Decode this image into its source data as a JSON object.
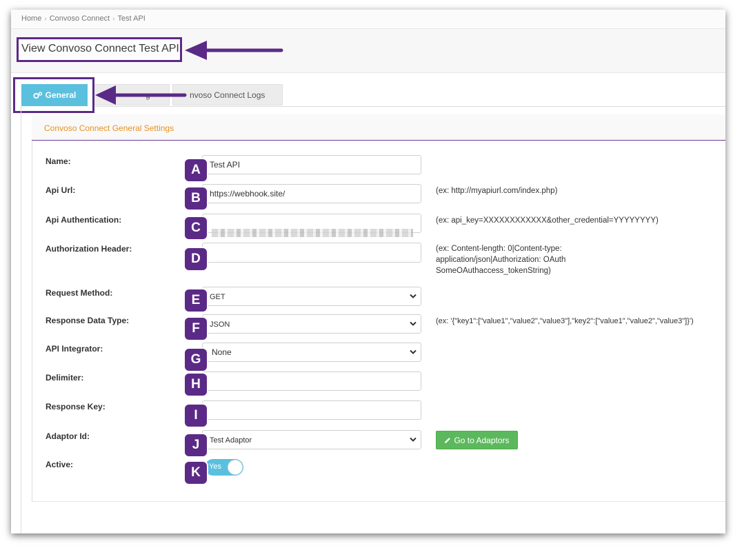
{
  "breadcrumb": {
    "home": "Home",
    "parent": "Convoso Connect",
    "current": "Test API"
  },
  "page_title": "View Convoso Connect Test API",
  "tabs": {
    "general": "General",
    "hidden_fragment": "g",
    "logs": "nvoso Connect Logs"
  },
  "panel_title": "Convoso Connect General Settings",
  "fields": {
    "name": {
      "label": "Name:",
      "value": "Test API",
      "badge": "A"
    },
    "api_url": {
      "label": "Api Url:",
      "value": "https://webhook.site/",
      "hint": "(ex: http://myapiurl.com/index.php)",
      "badge": "B"
    },
    "api_auth": {
      "label": "Api Authentication:",
      "hint": "(ex: api_key=XXXXXXXXXXXX&other_credential=YYYYYYYY)",
      "badge": "C"
    },
    "auth_header": {
      "label": "Authorization Header:",
      "hint_line1": "(ex: Content-length: 0|Content-type:",
      "hint_line2": "application/json|Authorization: OAuth",
      "hint_line3": "SomeOAuthaccess_tokenString)",
      "badge": "D"
    },
    "request_method": {
      "label": "Request Method:",
      "value": "GET",
      "badge": "E"
    },
    "response_type": {
      "label": "Response Data Type:",
      "value": "JSON",
      "hint": "(ex: '{\"key1\":[\"value1\",\"value2\",\"value3\"],\"key2\":[\"value1\",\"value2\",\"value3\"]}')",
      "badge": "F"
    },
    "api_integrator": {
      "label": "API Integrator:",
      "value": "None",
      "badge": "G"
    },
    "delimiter": {
      "label": "Delimiter:",
      "badge": "H"
    },
    "response_key": {
      "label": "Response Key:",
      "badge": "I"
    },
    "adaptor_id": {
      "label": "Adaptor Id:",
      "value": "Test Adaptor",
      "badge": "J"
    },
    "active": {
      "label": "Active:",
      "value": "Yes",
      "badge": "K"
    }
  },
  "buttons": {
    "go_to_adaptors": "Go to Adaptors"
  },
  "colors": {
    "annotation_purple": "#5b2a86",
    "tab_active": "#5bc0de",
    "button_green": "#5cb85c",
    "panel_title": "#e8911f"
  }
}
